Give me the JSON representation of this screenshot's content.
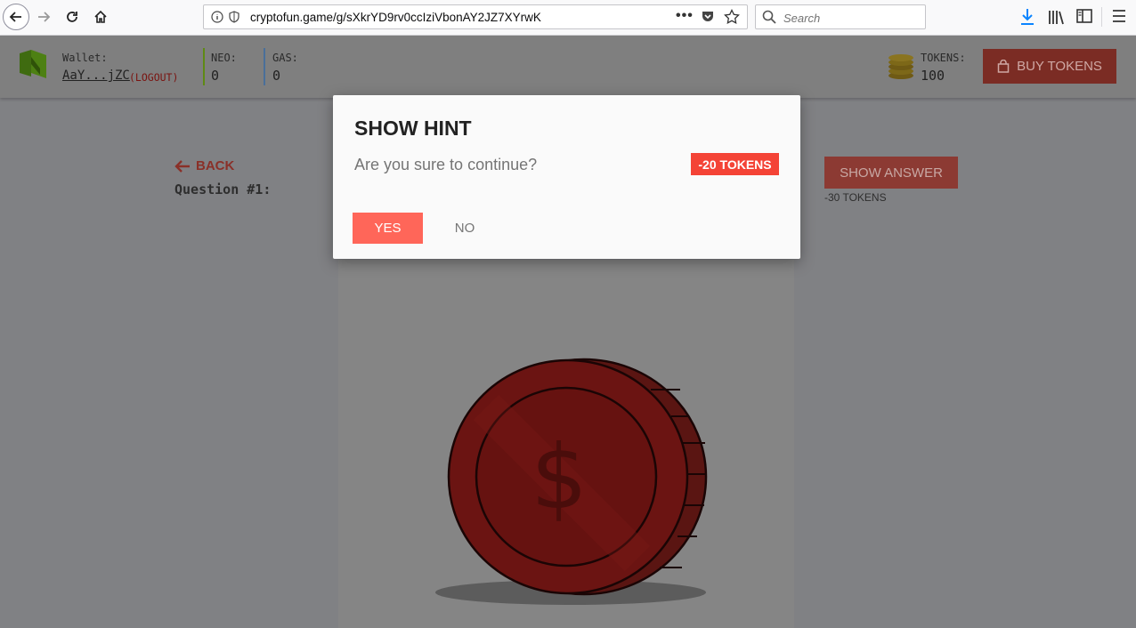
{
  "browser": {
    "url": "cryptofun.game/g/sXkrYD9rv0ccIziVbonAY2JZ7XYrwK",
    "search_placeholder": "Search"
  },
  "header": {
    "wallet_label": "Wallet:",
    "wallet_address": "AaY...jZC",
    "logout_label": "(LOGOUT)",
    "neo_label": "NEO:",
    "neo_value": "0",
    "gas_label": "GAS:",
    "gas_value": "0",
    "tokens_label": "TOKENS:",
    "tokens_value": "100",
    "buy_label": "BUY TOKENS"
  },
  "page": {
    "back_label": "BACK",
    "question_label": "Question #1:",
    "show_answer_label": "SHOW ANSWER",
    "answer_cost": "-30 TOKENS"
  },
  "modal": {
    "title": "SHOW HINT",
    "message": "Are you sure to continue?",
    "cost": "-20 TOKENS",
    "yes_label": "YES",
    "no_label": "NO"
  },
  "colors": {
    "accent": "#f44336",
    "yes_button": "#ff6659",
    "overlay": "#808184",
    "coin": "#6b1412"
  }
}
